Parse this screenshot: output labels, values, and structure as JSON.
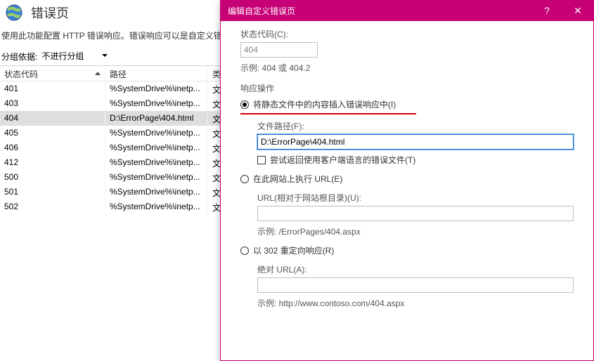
{
  "page": {
    "title": "错误页",
    "description": "使用此功能配置 HTTP 错误响应。错误响应可以是自定义错误",
    "grouping_label": "分组依据:",
    "grouping_value": "不进行分组"
  },
  "table": {
    "columns": {
      "status": "状态代码",
      "path": "路径",
      "type": "类型"
    },
    "rows": [
      {
        "status": "401",
        "path": "%SystemDrive%\\inetp...",
        "type": "文件",
        "selected": false
      },
      {
        "status": "403",
        "path": "%SystemDrive%\\inetp...",
        "type": "文件",
        "selected": false
      },
      {
        "status": "404",
        "path": "D:\\ErrorPage\\404.html",
        "type": "文件",
        "selected": true
      },
      {
        "status": "405",
        "path": "%SystemDrive%\\inetp...",
        "type": "文件",
        "selected": false
      },
      {
        "status": "406",
        "path": "%SystemDrive%\\inetp...",
        "type": "文件",
        "selected": false
      },
      {
        "status": "412",
        "path": "%SystemDrive%\\inetp...",
        "type": "文件",
        "selected": false
      },
      {
        "status": "500",
        "path": "%SystemDrive%\\inetp...",
        "type": "文件",
        "selected": false
      },
      {
        "status": "501",
        "path": "%SystemDrive%\\inetp...",
        "type": "文件",
        "selected": false
      },
      {
        "status": "502",
        "path": "%SystemDrive%\\inetp...",
        "type": "文件",
        "selected": false
      }
    ]
  },
  "dialog": {
    "title": "编辑自定义错误页",
    "help_symbol": "?",
    "close_symbol": "✕",
    "status_code_label": "状态代码(C):",
    "status_code_value": "404",
    "status_code_hint": "示例: 404 或 404.2",
    "response_group_label": "响应操作",
    "opt_static_label": "将静态文件中的内容插入错误响应中(I)",
    "file_path_label": "文件路径(F):",
    "file_path_value": "D:\\ErrorPage\\404.html",
    "try_localized_label": "尝试返回使用客户端语言的错误文件(T)",
    "opt_execute_url_label": "在此网站上执行 URL(E)",
    "url_relative_label": "URL(相对于网站根目录)(U):",
    "url_relative_value": "",
    "url_relative_hint": "示例: /ErrorPages/404.aspx",
    "opt_redirect_label": "以 302 重定向响应(R)",
    "absolute_url_label": "绝对 URL(A):",
    "absolute_url_value": "",
    "absolute_url_hint": "示例: http://www.contoso.com/404.aspx"
  }
}
